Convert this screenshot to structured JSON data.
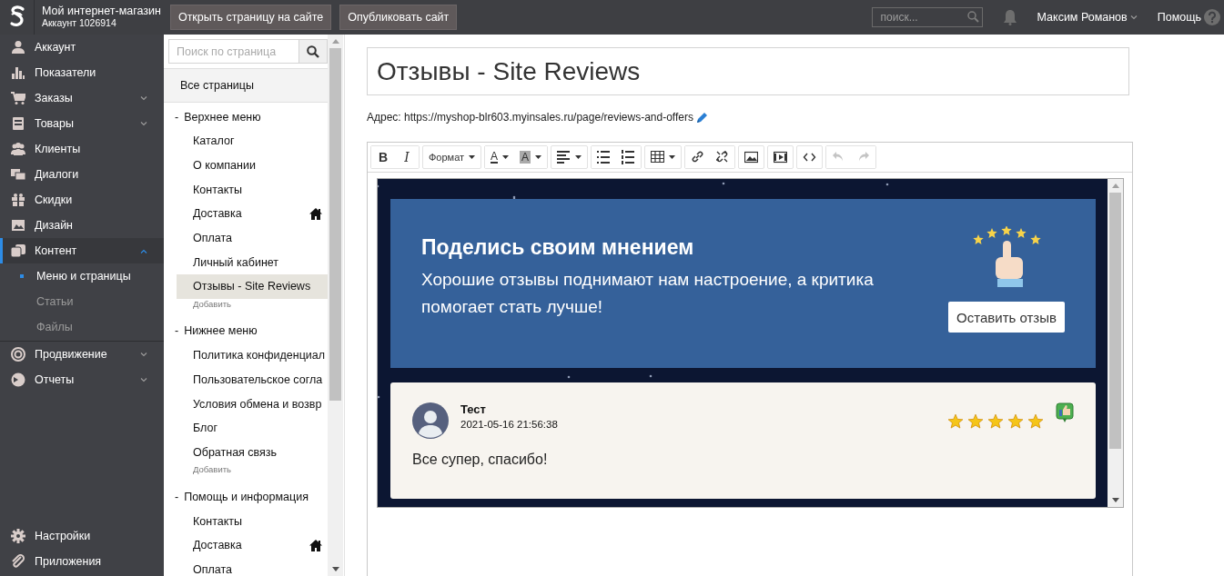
{
  "header": {
    "shop_name": "Мой интернет-магазин",
    "account": "Аккаунт 1026914",
    "buttons": [
      "Открыть страницу на сайте",
      "Опубликовать сайт"
    ],
    "search": {
      "placeholder": "поиск..."
    },
    "user": "Максим Романов",
    "help": "Помощь"
  },
  "sidebar": {
    "items": [
      {
        "label": "Аккаунт",
        "selected": false
      },
      {
        "label": "Показатели",
        "selected": false
      },
      {
        "label": "Заказы",
        "expanded": false,
        "selected": false
      },
      {
        "label": "Товары",
        "expanded": false,
        "selected": false
      },
      {
        "label": "Клиенты",
        "selected": false
      },
      {
        "label": "Диалоги",
        "selected": false
      },
      {
        "label": "Скидки",
        "selected": false
      },
      {
        "label": "Дизайн",
        "selected": false
      },
      {
        "label": "Контент",
        "expanded": true,
        "selected": true,
        "children": [
          {
            "label": "Меню и страницы",
            "selected": true
          },
          {
            "label": "Статьи",
            "selected": false
          },
          {
            "label": "Файлы",
            "selected": false
          }
        ]
      },
      {
        "label": "Продвижение",
        "expanded": false,
        "selected": false
      },
      {
        "label": "Отчеты",
        "expanded": false,
        "selected": false
      }
    ],
    "bottom_items": [
      {
        "label": "Настройки"
      },
      {
        "label": "Приложения"
      }
    ]
  },
  "pages": {
    "search": {
      "placeholder": "Поиск по страница"
    },
    "all_pages": "Все страницы",
    "groups": [
      {
        "toggle": "-",
        "title": "Верхнее меню",
        "add": "Добавить",
        "children": [
          {
            "label": "Каталог",
            "home": false,
            "selected": false
          },
          {
            "label": "О компании",
            "home": false,
            "selected": false
          },
          {
            "label": "Контакты",
            "home": false,
            "selected": false
          },
          {
            "label": "Доставка",
            "home": true,
            "selected": false
          },
          {
            "label": "Оплата",
            "home": false,
            "selected": false
          },
          {
            "label": "Личный кабинет",
            "home": false,
            "selected": false
          },
          {
            "label": "Отзывы - Site Reviews",
            "home": false,
            "selected": true
          }
        ]
      },
      {
        "toggle": "-",
        "title": "Нижнее меню",
        "add": "Добавить",
        "children": [
          {
            "label": "Политика конфиденциал",
            "home": false,
            "selected": false
          },
          {
            "label": "Пользовательское согла",
            "home": false,
            "selected": false
          },
          {
            "label": "Условия обмена и возвр",
            "home": false,
            "selected": false
          },
          {
            "label": "Блог",
            "home": false,
            "selected": false
          },
          {
            "label": "Обратная связь",
            "home": false,
            "selected": false
          }
        ]
      },
      {
        "toggle": "-",
        "title": "Помощь и информация",
        "children": [
          {
            "label": "Контакты",
            "home": false,
            "selected": false
          },
          {
            "label": "Доставка",
            "home": true,
            "selected": false
          },
          {
            "label": "Оплата",
            "home": false,
            "selected": false
          }
        ]
      }
    ]
  },
  "editor": {
    "title": "Отзывы - Site Reviews",
    "address_label": "Адрес:",
    "url": "https://myshop-blr603.myinsales.ru/page/reviews-and-offers",
    "toolbar": [
      [
        {
          "kind": "bold",
          "glyph": "B",
          "dropdown": false,
          "disabled": false
        },
        {
          "kind": "italic",
          "glyph": "I",
          "dropdown": false,
          "disabled": false
        }
      ],
      [
        {
          "kind": "format",
          "label": "Формат",
          "dropdown": true,
          "disabled": false
        }
      ],
      [
        {
          "kind": "text-color",
          "glyph": "A",
          "dropdown": true,
          "disabled": false
        },
        {
          "kind": "bg-color",
          "glyph": "A",
          "dropdown": true,
          "disabled": false
        }
      ],
      [
        {
          "kind": "align",
          "dropdown": true,
          "disabled": false
        }
      ],
      [
        {
          "kind": "bullet-list",
          "dropdown": false,
          "disabled": false
        },
        {
          "kind": "number-list",
          "dropdown": false,
          "disabled": false
        }
      ],
      [
        {
          "kind": "table",
          "dropdown": true,
          "disabled": false
        }
      ],
      [
        {
          "kind": "link",
          "dropdown": false,
          "disabled": false
        },
        {
          "kind": "unlink",
          "dropdown": false,
          "disabled": false
        }
      ],
      [
        {
          "kind": "image",
          "dropdown": false,
          "disabled": false
        }
      ],
      [
        {
          "kind": "video",
          "dropdown": false,
          "disabled": false
        }
      ],
      [
        {
          "kind": "code",
          "dropdown": false,
          "disabled": false
        }
      ],
      [
        {
          "kind": "undo",
          "dropdown": false,
          "disabled": true
        },
        {
          "kind": "redo",
          "dropdown": false,
          "disabled": true
        }
      ]
    ],
    "banner": {
      "heading": "Поделись своим мнением",
      "text": "Хорошие отзывы поднимают нам настроение, а критика помогает стать лучше!",
      "button": "Оставить отзыв"
    },
    "review": {
      "author": "Тест",
      "date": "2021-05-16 21:56:38",
      "text": "Все супер, спасибо!",
      "stars": 5
    }
  }
}
